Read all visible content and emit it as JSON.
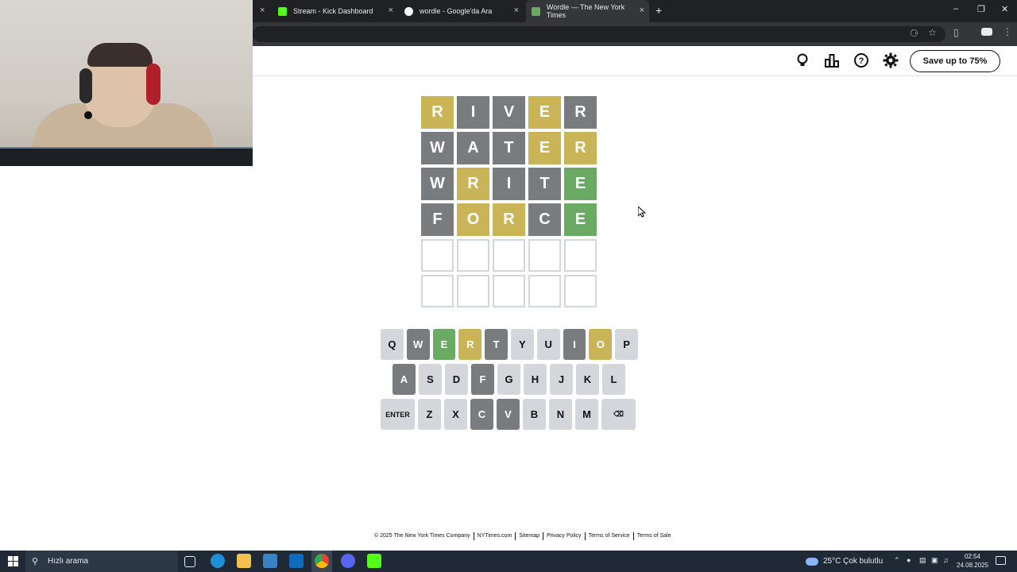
{
  "browser": {
    "tabs": [
      {
        "title": "Stream - Kick Dashboard",
        "favicon_color": "#53fc18"
      },
      {
        "title": "wordle - Google'da Ara",
        "favicon_color": "#ffffff"
      },
      {
        "title": "Wordle — The New York Times",
        "favicon_color": "#6aaa64"
      }
    ],
    "new_tab": "+",
    "close_glyph": "×"
  },
  "header": {
    "save_button": "Save up to 75%",
    "icons": [
      "lightbulb-icon",
      "leaderboard-icon",
      "help-icon",
      "settings-icon"
    ]
  },
  "board": {
    "rows": [
      [
        {
          "l": "R",
          "s": "present"
        },
        {
          "l": "I",
          "s": "absent"
        },
        {
          "l": "V",
          "s": "absent"
        },
        {
          "l": "E",
          "s": "present"
        },
        {
          "l": "R",
          "s": "absent"
        }
      ],
      [
        {
          "l": "W",
          "s": "absent"
        },
        {
          "l": "A",
          "s": "absent"
        },
        {
          "l": "T",
          "s": "absent"
        },
        {
          "l": "E",
          "s": "present"
        },
        {
          "l": "R",
          "s": "present"
        }
      ],
      [
        {
          "l": "W",
          "s": "absent"
        },
        {
          "l": "R",
          "s": "present"
        },
        {
          "l": "I",
          "s": "absent"
        },
        {
          "l": "T",
          "s": "absent"
        },
        {
          "l": "E",
          "s": "correct"
        }
      ],
      [
        {
          "l": "F",
          "s": "absent"
        },
        {
          "l": "O",
          "s": "present"
        },
        {
          "l": "R",
          "s": "present"
        },
        {
          "l": "C",
          "s": "absent"
        },
        {
          "l": "E",
          "s": "correct"
        }
      ],
      [
        {
          "l": "",
          "s": "empty"
        },
        {
          "l": "",
          "s": "empty"
        },
        {
          "l": "",
          "s": "empty"
        },
        {
          "l": "",
          "s": "empty"
        },
        {
          "l": "",
          "s": "empty"
        }
      ],
      [
        {
          "l": "",
          "s": "empty"
        },
        {
          "l": "",
          "s": "empty"
        },
        {
          "l": "",
          "s": "empty"
        },
        {
          "l": "",
          "s": "empty"
        },
        {
          "l": "",
          "s": "empty"
        }
      ]
    ]
  },
  "keyboard": {
    "rows": [
      [
        {
          "k": "Q",
          "s": "unused"
        },
        {
          "k": "W",
          "s": "absent"
        },
        {
          "k": "E",
          "s": "correct"
        },
        {
          "k": "R",
          "s": "present"
        },
        {
          "k": "T",
          "s": "absent"
        },
        {
          "k": "Y",
          "s": "unused"
        },
        {
          "k": "U",
          "s": "unused"
        },
        {
          "k": "I",
          "s": "absent"
        },
        {
          "k": "O",
          "s": "present"
        },
        {
          "k": "P",
          "s": "unused"
        }
      ],
      [
        {
          "k": "A",
          "s": "absent"
        },
        {
          "k": "S",
          "s": "unused"
        },
        {
          "k": "D",
          "s": "unused"
        },
        {
          "k": "F",
          "s": "absent"
        },
        {
          "k": "G",
          "s": "unused"
        },
        {
          "k": "H",
          "s": "unused"
        },
        {
          "k": "J",
          "s": "unused"
        },
        {
          "k": "K",
          "s": "unused"
        },
        {
          "k": "L",
          "s": "unused"
        }
      ],
      [
        {
          "k": "ENTER",
          "s": "unused",
          "wide": true
        },
        {
          "k": "Z",
          "s": "unused"
        },
        {
          "k": "X",
          "s": "unused"
        },
        {
          "k": "C",
          "s": "absent"
        },
        {
          "k": "V",
          "s": "absent"
        },
        {
          "k": "B",
          "s": "unused"
        },
        {
          "k": "N",
          "s": "unused"
        },
        {
          "k": "M",
          "s": "unused"
        },
        {
          "k": "⌫",
          "s": "unused",
          "wide": true
        }
      ]
    ]
  },
  "footer": {
    "links": [
      "© 2025 The New York Times Company",
      "NYTimes.com",
      "Sitemap",
      "Privacy Policy",
      "Terms of Service",
      "Terms of Sale"
    ]
  },
  "taskbar": {
    "search_placeholder": "Hızlı arama",
    "weather": "25°C  Çok bulutlu",
    "time": "02:54",
    "date": "24.08.2025"
  }
}
